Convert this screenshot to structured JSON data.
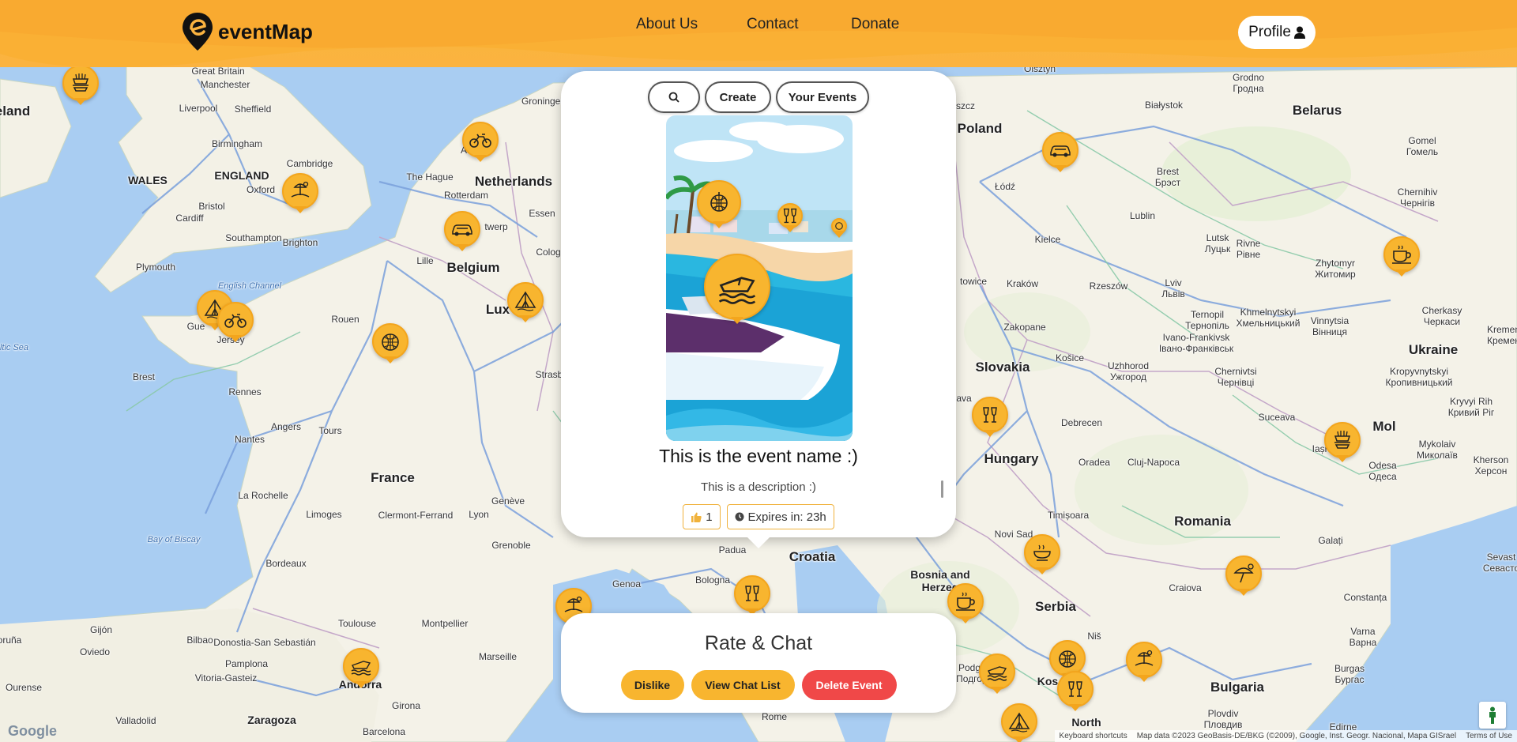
{
  "header": {
    "logo_text": "eventMap",
    "nav": [
      {
        "label": "About Us"
      },
      {
        "label": "Contact"
      },
      {
        "label": "Donate"
      }
    ],
    "profile_label": "Profile"
  },
  "event_card": {
    "tabs": {
      "create": "Create",
      "your_events": "Your Events"
    },
    "event_name": "This is the event name :)",
    "description": "This is a description :)",
    "likes": "1",
    "expires": "Expires in: 23h"
  },
  "rate_chat": {
    "title": "Rate & Chat",
    "dislike": "Dislike",
    "chat_list": "View Chat List",
    "delete": "Delete Event"
  },
  "map": {
    "labels": {
      "eland": "eland",
      "great_britain": "Great Britain",
      "manchester": "Manchester",
      "liverpool": "Liverpool",
      "sheffield": "Sheffield",
      "birmingham": "Birmingham",
      "wales": "WALES",
      "england": "ENGLAND",
      "cambridge": "Cambridge",
      "oxford": "Oxford",
      "bristol": "Bristol",
      "cardiff": "Cardiff",
      "southampton": "Southampton",
      "brighton": "Brighton",
      "plymouth": "Plymouth",
      "english_channel": "English Channel",
      "celtic_sea": "ltic Sea",
      "guernsey": "Gue",
      "jersey": "Jersey",
      "groningen": "Groningen",
      "amsterdam": "Am",
      "hague": "The Hague",
      "netherlands": "Netherlands",
      "rotterdam": "Rotterdam",
      "antwerp": "twerp",
      "essen": "Essen",
      "cologne": "Colog",
      "belgium": "Belgium",
      "lux": "Lux",
      "lille": "Lille",
      "rouen": "Rouen",
      "rennes": "Rennes",
      "brest": "Brest",
      "nantes": "Nantes",
      "angers": "Angers",
      "tours": "Tours",
      "france": "France",
      "strasb": "Strasb",
      "la_rochelle": "La Rochelle",
      "limoges": "Limoges",
      "clermont": "Clermont-Ferrand",
      "lyon": "Lyon",
      "geneva": "Genève",
      "grenoble": "Grenoble",
      "bay_biscay": "Bay of Biscay",
      "bordeaux": "Bordeaux",
      "toulouse": "Toulouse",
      "montpellier": "Montpellier",
      "marseille": "Marseille",
      "bilbao": "Bilbao",
      "oviedo": "Oviedo",
      "gijon": "Gijón",
      "donostia": "Donostia-San Sebastián",
      "pamplona": "Pamplona",
      "vitoria": "Vitoria-Gasteiz",
      "ourense": "Ourense",
      "valladolid": "Valladolid",
      "zaragoza": "Zaragoza",
      "andorra": "Andorra",
      "girona": "Girona",
      "barcelona": "Barcelona",
      "oruna": "oruña",
      "genoa": "Genoa",
      "bologna": "Bologna",
      "padua": "Padua",
      "rome": "Rome",
      "croatia": "Croatia",
      "poland": "Poland",
      "lodz": "Łódź",
      "kielce": "Kielce",
      "lublin": "Lublin",
      "krakow": "Kraków",
      "rzeszow": "Rzeszów",
      "zakopane": "Zakopane",
      "katowice": "towice",
      "olsztyn": "Olsztyn",
      "bialystok": "Białystok",
      "grodno": "Grodno\nГродна",
      "belarus": "Belarus",
      "brest_by": "Brest\nБрэст",
      "gomel": "Gomel\nГомель",
      "chernihiv": "Chernihiv\nЧернігів",
      "lutsk": "Lutsk\nЛуцьк",
      "rivne": "Rivne\nРівне",
      "zhytomyr": "Zhytomyr\nЖитомир",
      "lviv": "Lviv\nЛьвів",
      "ternopil": "Ternopil\nТернопіль",
      "khmelnytskyi": "Khmelnytskyi\nХмельницький",
      "vinnytsia": "Vinnytsia\nВінниця",
      "ivano": "Ivano-Frankivsk\nІвано-Франківськ",
      "cherkasy": "Cherkasy\nЧеркаси",
      "kremen": "Kremen\nКремен",
      "ukraine": "Ukraine",
      "chernivtsi": "Chernivtsi\nЧернівці",
      "kropyvnytskyi": "Kropyvnytskyi\nКропивницький",
      "kryvyi": "Kryvyi Rih\nКривий Ріг",
      "mykolaiv": "Mykolaiv\nМиколаїв",
      "odesa": "Odesa\nОдеса",
      "kherson": "Kherson\nХерсон",
      "slovakia": "Slovakia",
      "kosice": "Košice",
      "uzhhorod": "Uzhhorod\nУжгород",
      "hungary": "Hungary",
      "debrecen": "Debrecen",
      "cluj": "Cluj-Napoca",
      "oradea": "Oradea",
      "suceava": "Suceava",
      "iasi": "Iași",
      "mol": "Mol",
      "romania": "Romania",
      "timisoara": "Timișoara",
      "galati": "Galați",
      "novi_sad": "Novi Sad",
      "serbia": "Serbia",
      "bosnia": "Bosnia and\nHerzeg",
      "craiova": "Craiova",
      "constanta": "Constanța",
      "nis": "Niš",
      "varna": "Varna\nВарна",
      "burgas": "Burgas\nБургас",
      "bulgaria": "Bulgaria",
      "plovdiv": "Plovdiv\nПловдив",
      "podgorica": "Podgorica\nПодгорица",
      "kos": "Kos",
      "north": "North",
      "edirne": "Edirne",
      "sevastopol": "Sevast\nСевасто",
      "bava": "ava",
      "bst": "B st",
      "sz": "szcz"
    }
  },
  "footer": {
    "google": "Google",
    "keyboard": "Keyboard shortcuts",
    "map_data": "Map data ©2023 GeoBasis-DE/BKG (©2009), Google, Inst. Geogr. Nacional, Mapa GISrael",
    "terms": "Terms of Use"
  },
  "colors": {
    "accent": "#f8b52f",
    "header": "#fbb340",
    "danger": "#f04848",
    "water": "#a9cdf2",
    "land": "#f5f3ea"
  },
  "icons": {
    "pins": [
      "burger-fries",
      "motorcycle",
      "beach",
      "car",
      "tent",
      "food",
      "lighthouse",
      "disco-ball",
      "cheers",
      "coffee",
      "boat",
      "camp",
      "umbrella"
    ]
  }
}
